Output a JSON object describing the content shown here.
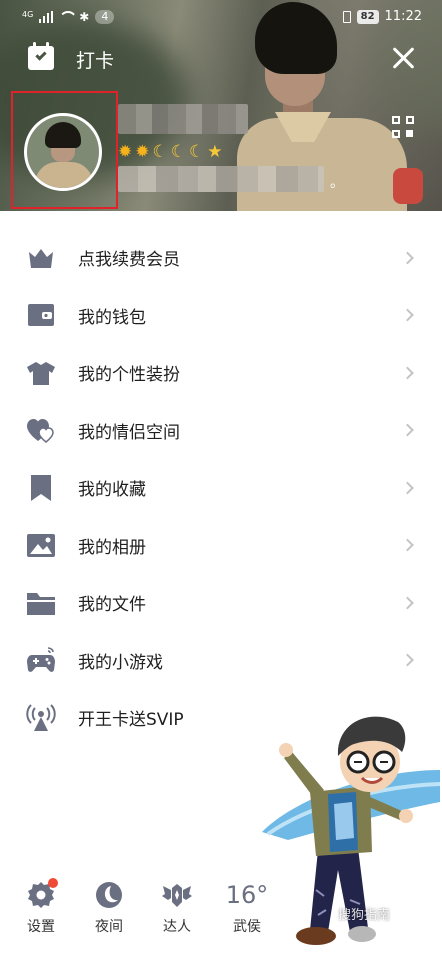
{
  "status_bar": {
    "network": "4G",
    "notification_count": "4",
    "battery": "82",
    "time": "11:22"
  },
  "header": {
    "checkin_label": "打卡",
    "level_icons": [
      "sun",
      "sun",
      "moon",
      "moon",
      "moon",
      "star"
    ],
    "signature_suffix": "。"
  },
  "menu": {
    "items": [
      {
        "label": "点我续费会员",
        "icon": "crown-icon",
        "chevron": true
      },
      {
        "label": "我的钱包",
        "icon": "wallet-icon",
        "chevron": true
      },
      {
        "label": "我的个性装扮",
        "icon": "shirt-icon",
        "chevron": true
      },
      {
        "label": "我的情侣空间",
        "icon": "hearts-icon",
        "chevron": true
      },
      {
        "label": "我的收藏",
        "icon": "bookmark-icon",
        "chevron": true
      },
      {
        "label": "我的相册",
        "icon": "photo-icon",
        "chevron": true
      },
      {
        "label": "我的文件",
        "icon": "folder-icon",
        "chevron": true
      },
      {
        "label": "我的小游戏",
        "icon": "gamepad-icon",
        "chevron": true
      },
      {
        "label": "开王卡送SVIP",
        "icon": "antenna-icon",
        "chevron": false
      }
    ]
  },
  "bottom_bar": {
    "settings_label": "设置",
    "night_label": "夜间",
    "expert_label": "达人",
    "weather_temp": "16°",
    "weather_city": "武侯"
  },
  "watermark": "搜狗指南",
  "colors": {
    "icon_gray": "#6b6f82",
    "highlight_red": "#e0222a",
    "badge_red": "#f04a36"
  }
}
